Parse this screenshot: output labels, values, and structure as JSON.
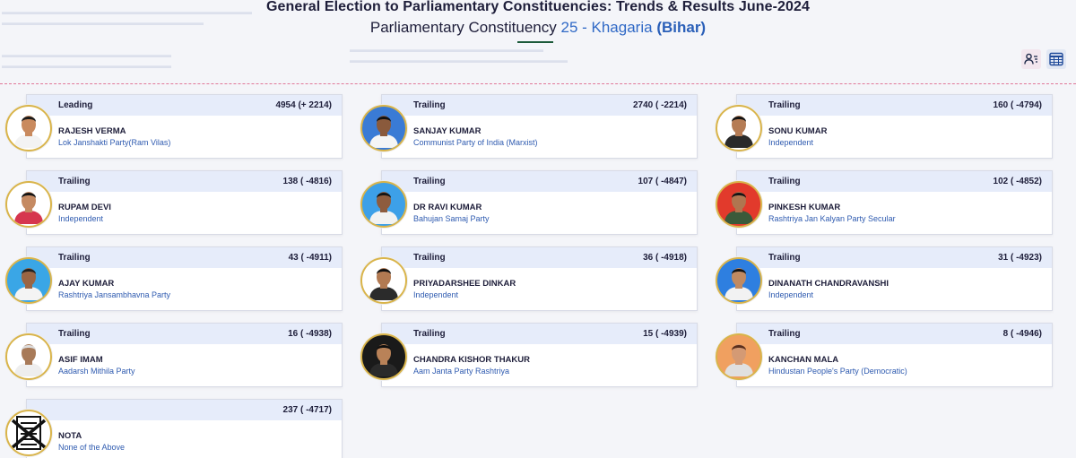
{
  "header": {
    "title": "General Election to Parliamentary Constituencies: Trends & Results June-2024",
    "subtitle_prefix": "Parliamentary Constituency",
    "constituency": "25 - Khagaria",
    "state": "(Bihar)"
  },
  "toolbar": {
    "candidate_view_icon": "person-list-icon",
    "grid_view_icon": "grid-view-icon"
  },
  "colors": {
    "accent_blue": "#2a5fb8",
    "card_header": "#e6ecfa",
    "ring": "#d9b44a",
    "dashed_divider": "#e07898"
  },
  "candidates": [
    {
      "status": "Leading",
      "votes": "4954 (+ 2214)",
      "name": "RAJESH VERMA",
      "party": "Lok Janshakti Party(Ram Vilas)",
      "photo_bg": "#ffffff",
      "skin": "#c98a5e",
      "shirt": "#f3f3f3",
      "hair": "#1a1a1a"
    },
    {
      "status": "Trailing",
      "votes": "2740 ( -2214)",
      "name": "SANJAY KUMAR",
      "party": "Communist Party of India (Marxist)",
      "photo_bg": "#3a7bd5",
      "skin": "#8a5a3c",
      "shirt": "#f5f5f5",
      "hair": "#111111"
    },
    {
      "status": "Trailing",
      "votes": "160 ( -4794)",
      "name": "SONU KUMAR",
      "party": "Independent",
      "photo_bg": "#ffffff",
      "skin": "#b57c55",
      "shirt": "#2a2a2a",
      "hair": "#121212"
    },
    {
      "status": "Trailing",
      "votes": "138 ( -4816)",
      "name": "RUPAM DEVI",
      "party": "Independent",
      "photo_bg": "#ffffff",
      "skin": "#c58a62",
      "shirt": "#d6364e",
      "hair": "#141414"
    },
    {
      "status": "Trailing",
      "votes": "107 ( -4847)",
      "name": "DR RAVI KUMAR",
      "party": "Bahujan Samaj Party",
      "photo_bg": "#3da0e8",
      "skin": "#8e5c3e",
      "shirt": "#f2f2f2",
      "hair": "#151515"
    },
    {
      "status": "Trailing",
      "votes": "102 ( -4852)",
      "name": "PINKESH KUMAR",
      "party": "Rashtriya Jan Kalyan Party Secular",
      "photo_bg": "#e23a2c",
      "skin": "#b07650",
      "shirt": "#3a5a3a",
      "hair": "#161616"
    },
    {
      "status": "Trailing",
      "votes": "43 ( -4911)",
      "name": "AJAY KUMAR",
      "party": "Rashtriya Jansambhavna Party",
      "photo_bg": "#3aa6e6",
      "skin": "#9a6544",
      "shirt": "#f4f4f4",
      "hair": "#222222"
    },
    {
      "status": "Trailing",
      "votes": "36 ( -4918)",
      "name": "PRIYADARSHEE DINKAR",
      "party": "Independent",
      "photo_bg": "#ffffff",
      "skin": "#b27a52",
      "shirt": "#2b2b2b",
      "hair": "#121212"
    },
    {
      "status": "Trailing",
      "votes": "31 ( -4923)",
      "name": "DINANATH CHANDRAVANSHI",
      "party": "Independent",
      "photo_bg": "#2e7fe0",
      "skin": "#c08a62",
      "shirt": "#f2f2f2",
      "hair": "#141414"
    },
    {
      "status": "Trailing",
      "votes": "16 ( -4938)",
      "name": "ASIF IMAM",
      "party": "Aadarsh Mithila Party",
      "photo_bg": "#ffffff",
      "skin": "#a87a58",
      "shirt": "#eeeeee",
      "hair": "#dddddd"
    },
    {
      "status": "Trailing",
      "votes": "15 ( -4939)",
      "name": "CHANDRA KISHOR THAKUR",
      "party": "Aam Janta Party Rashtriya",
      "photo_bg": "#1a1a1a",
      "skin": "#b98258",
      "shirt": "#2a2a2a",
      "hair": "#0f0f0f"
    },
    {
      "status": "Trailing",
      "votes": "8 ( -4946)",
      "name": "KANCHAN MALA",
      "party": "Hindustan People's Party (Democratic)",
      "photo_bg": "#f0a060",
      "skin": "#d49a74",
      "shirt": "#e0e0e0",
      "hair": "#5a2f1c"
    },
    {
      "status": "",
      "votes": "237 ( -4717)",
      "name": "NOTA",
      "party": "None of the Above",
      "is_nota": true
    }
  ]
}
